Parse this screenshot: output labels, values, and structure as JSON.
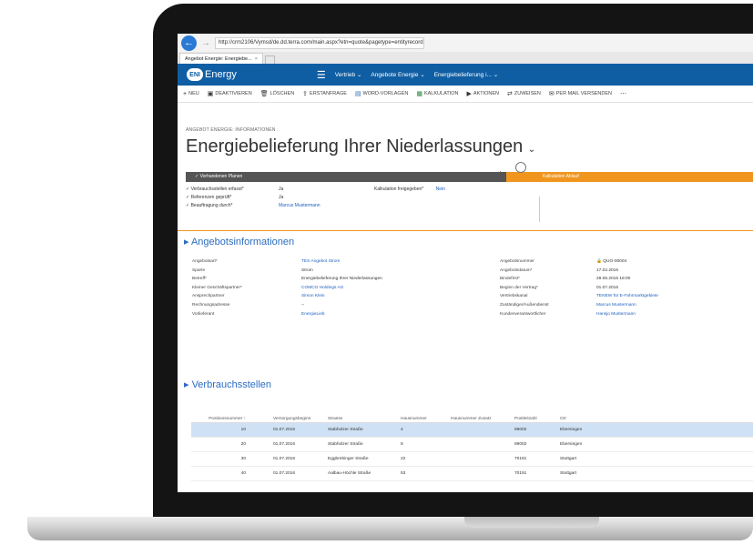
{
  "browser": {
    "url": "http://crm2106/Vymsd/de.dd.terra.com/main.aspx?etn=quote&pagetype=entityrecord",
    "tab_title": "Angebot Energie: Energiebe...",
    "back_glyph": "←",
    "forward_glyph": "→",
    "tab_close_glyph": "×"
  },
  "app": {
    "logo_badge": "ENI",
    "logo_text": "Energy",
    "hamburger_glyph": "☰",
    "nav_items": [
      "Vertrieb",
      "Angebote Energie",
      "Energiebelieferung i..."
    ],
    "nav_chevron": "⌄",
    "brand_color": "#0f5ea4",
    "accent_color": "#f0961e",
    "link_color": "#1e5fbf"
  },
  "commands": [
    {
      "icon": "+",
      "label": "NEU",
      "icon_name": "plus-icon",
      "tone": ""
    },
    {
      "icon": "▣",
      "label": "DEAKTIVIEREN",
      "icon_name": "deactivate-icon",
      "tone": ""
    },
    {
      "icon": "🗑",
      "label": "LÖSCHEN",
      "icon_name": "trash-icon",
      "tone": ""
    },
    {
      "icon": "⇪",
      "label": "ERSTANFRAGE",
      "icon_name": "request-icon",
      "tone": ""
    },
    {
      "icon": "▤",
      "label": "WORD-VORLAGEN",
      "icon_name": "word-icon",
      "tone": "blue"
    },
    {
      "icon": "▦",
      "label": "KALKULATION",
      "icon_name": "excel-icon",
      "tone": "green"
    },
    {
      "icon": "▶",
      "label": "AKTIONEN",
      "icon_name": "play-icon",
      "tone": ""
    },
    {
      "icon": "⇄",
      "label": "ZUWEISEN",
      "icon_name": "assign-icon",
      "tone": ""
    },
    {
      "icon": "✉",
      "label": "PER MAIL VERSENDEN",
      "icon_name": "email-icon",
      "tone": ""
    },
    {
      "icon": "⋯",
      "label": "",
      "icon_name": "more-icon",
      "tone": ""
    }
  ],
  "record": {
    "entity_label": "ANGEBOT ENERGIE: INFORMATIONEN",
    "title": "Energiebelieferung Ihrer Niederlassungen",
    "title_chevron": "⌄"
  },
  "process": {
    "active_stage": "✓ Vorhandenen Planen",
    "next_stage": "Kalkulation Ablauf",
    "fields": [
      {
        "label": "✓ Verbrauchsstellen erfasst*",
        "value": "Ja",
        "link": false
      },
      {
        "label": "✓ Referenzen geprüft*",
        "value": "Ja",
        "link": false
      },
      {
        "label": "✓ Beauftragung durch*",
        "value": "Marcus Mustermann",
        "link": true
      }
    ],
    "right_field": {
      "label": "Kalkulation freigegeben*",
      "value": "Nein"
    }
  },
  "sections": {
    "info_heading": "▸ Angebotsinformationen",
    "consumption_heading": "▸ Verbrauchsstellen"
  },
  "info_left": [
    {
      "k": "Angebotsart*",
      "v": "TES Angebot Strom",
      "link": true
    },
    {
      "k": "Sparte",
      "v": "Strom",
      "link": false
    },
    {
      "k": "Betreff*",
      "v": "Energiebelieferung Ihrer Niederlassungen",
      "link": false
    },
    {
      "k": "Kleiner Geschäftspartner*",
      "v": "COMCO Holdings AG",
      "link": true
    },
    {
      "k": "Ansprechpartner",
      "v": "Simon Klein",
      "link": true
    },
    {
      "k": "Rechnungsadresse",
      "v": "--",
      "link": false
    },
    {
      "k": "Vorlieferant",
      "v": "EnergieLieb",
      "link": true
    }
  ],
  "info_right": [
    {
      "k": "Angebotsnummer",
      "v": "🔒 QUO-00004",
      "link": false
    },
    {
      "k": "Angebotsdatum*",
      "v": "17.02.2016",
      "link": false
    },
    {
      "k": "Bindefrist*",
      "v": "29.06.2016 18:00",
      "link": false
    },
    {
      "k": "Beginn der Vertrag*",
      "v": "01.07.2016",
      "link": false
    },
    {
      "k": "Vertriebskanal",
      "v": "TENEW für E-Fahrmarktgebiete",
      "link": true
    },
    {
      "k": "Zuständiger/Außendienst",
      "v": "Marcus Mustermann",
      "link": true
    },
    {
      "k": "Kundenverantwortlicher",
      "v": "Hansjo Mustermann",
      "link": true
    }
  ],
  "table": {
    "headers": [
      "Positionsnummer ↑",
      "Versorgungsbeginn",
      "Strasse",
      "Hausnummer",
      "Hausnummer Zusatz",
      "Postleitzahl",
      "Ort"
    ],
    "rows": [
      {
        "pos": "10",
        "date": "01.07.2016",
        "street": "Stabholzer Straße",
        "no": "4",
        "extra": "",
        "zip": "89002",
        "city": "Ebersingen",
        "selected": true
      },
      {
        "pos": "20",
        "date": "01.07.2016",
        "street": "Stabholzer Straße",
        "no": "8",
        "extra": "",
        "zip": "89002",
        "city": "Ebersingen",
        "selected": false
      },
      {
        "pos": "30",
        "date": "01.07.2016",
        "street": "Eggbrebinger Straße",
        "no": "22",
        "extra": "",
        "zip": "70191",
        "city": "Stuttgart",
        "selected": false
      },
      {
        "pos": "40",
        "date": "01.07.2016",
        "street": "Aalbau-Höchle Straße",
        "no": "53",
        "extra": "",
        "zip": "70191",
        "city": "Stuttgart",
        "selected": false
      }
    ]
  }
}
